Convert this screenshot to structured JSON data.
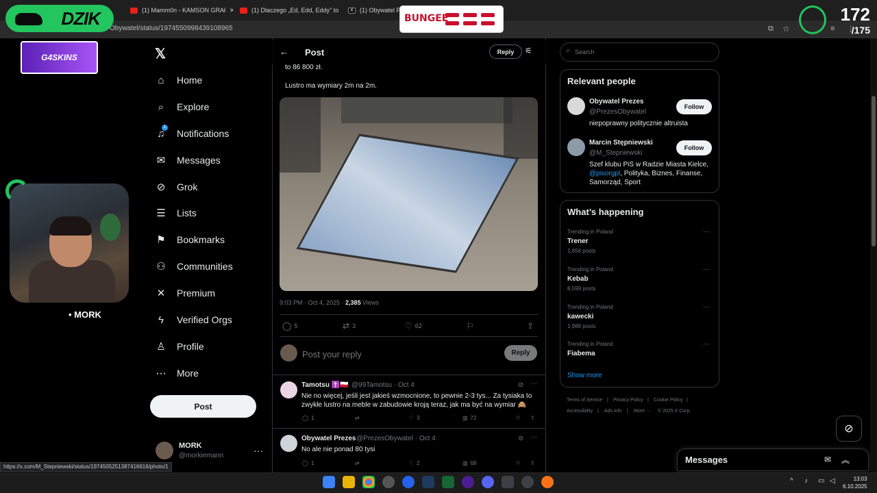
{
  "browser": {
    "tabs": [
      {
        "label": "(1) Mamm0n - KAMSON GRAł"
      },
      {
        "label": "(1) Dlaczego „Ed, Edd, Eddy\" to"
      },
      {
        "label": "(1) Obywatel Pre"
      }
    ],
    "url": "Obywatel/status/1974550998439108965",
    "status_url": "https://x.com/M_Stepniewski/status/1974505251387416616/photo/1"
  },
  "overlays": {
    "brand": "DZIK",
    "sponsor": "G4SKINS",
    "banner": "BUNGEE",
    "counter_main": "172",
    "counter_sub": "/175",
    "counter_mark": "/",
    "streamer": "MORK"
  },
  "nav": {
    "items": [
      {
        "label": "Home",
        "icon": "home-icon"
      },
      {
        "label": "Explore",
        "icon": "search-icon"
      },
      {
        "label": "Notifications",
        "icon": "bell-icon",
        "badge": "1"
      },
      {
        "label": "Messages",
        "icon": "envelope-icon"
      },
      {
        "label": "Grok",
        "icon": "grok-icon"
      },
      {
        "label": "Lists",
        "icon": "list-icon"
      },
      {
        "label": "Bookmarks",
        "icon": "bookmark-icon"
      },
      {
        "label": "Communities",
        "icon": "people-icon"
      },
      {
        "label": "Premium",
        "icon": "x-icon"
      },
      {
        "label": "Verified Orgs",
        "icon": "lightning-icon"
      },
      {
        "label": "Profile",
        "icon": "person-icon"
      },
      {
        "label": "More",
        "icon": "more-circle-icon"
      }
    ],
    "post_button": "Post",
    "account": {
      "name": "MORK",
      "handle": "@morkiemann"
    }
  },
  "post": {
    "header_title": "Post",
    "reply_top": "Reply",
    "text_line1": "to 86 800 zł.",
    "text_line2": "Lustro ma wymiary 2m na 2m.",
    "time": "9:03 PM · Oct 4, 2025 · ",
    "views_count": "2,385",
    "views_label": " Views",
    "stats": {
      "replies": "5",
      "reposts": "3",
      "likes": "62"
    },
    "reply_placeholder": "Post your reply",
    "reply_button": "Reply"
  },
  "comments": [
    {
      "name": "Tamotsu ✝️🇵🇱",
      "handle": "@99Tamotsu · Oct 4",
      "text": "Nie no więcej, jeśli jest jakieś wzmocnione, to pewnie 2-3 tys... Za tysiaka to zwykłe lustro na meble w zabudowie kroją teraz, jak ma być na wymiar 🙈",
      "replies": "1",
      "reposts": "",
      "likes": "3",
      "views": "72"
    },
    {
      "name": "Obywatel Prezes",
      "handle": "@PrezesObywatel · Oct 4",
      "text": "No ale nie ponad 80 tysi",
      "replies": "1",
      "reposts": "",
      "likes": "2",
      "views": "68"
    }
  ],
  "right": {
    "search_placeholder": "Search",
    "relevant_title": "Relevant people",
    "people": [
      {
        "name": "Obywatel Prezes",
        "handle": "@PrezesObywatel",
        "bio": "niepoprawny politycznie altruista",
        "follow": "Follow"
      },
      {
        "name": "Marcin Stępniewski",
        "handle": "@M_Stepniewski",
        "bio_pre": "Szef klubu PiS w Radzie Miasta Kielce, ",
        "bio_link": "@pisorgpl",
        "bio_post": ", Polityka, Biznes, Finanse, Samorząd, Sport",
        "follow": "Follow"
      }
    ],
    "happening_title": "What’s happening",
    "trends": [
      {
        "category": "Trending in Poland",
        "name": "Trener",
        "posts": "1,656 posts"
      },
      {
        "category": "Trending in Poland",
        "name": "Kebab",
        "posts": "8,599 posts"
      },
      {
        "category": "Trending in Poland",
        "name": "kawecki",
        "posts": "1,988 posts"
      },
      {
        "category": "Trending in Poland",
        "name": "Fiabema",
        "posts": ""
      }
    ],
    "show_more": "Show more",
    "footer": [
      "Terms of Service",
      "|",
      "Privacy Policy",
      "|",
      "Cookie Policy",
      "|",
      "Accessibility",
      "|",
      "Ads info",
      "|",
      "More ···",
      "© 2025 X Corp."
    ],
    "messages_title": "Messages"
  },
  "taskbar": {
    "time": "13:03",
    "date": "6.10.2025"
  },
  "colors": {
    "accent": "#1d9bf0",
    "brand_green": "#22c55e",
    "bg": "#000000"
  }
}
